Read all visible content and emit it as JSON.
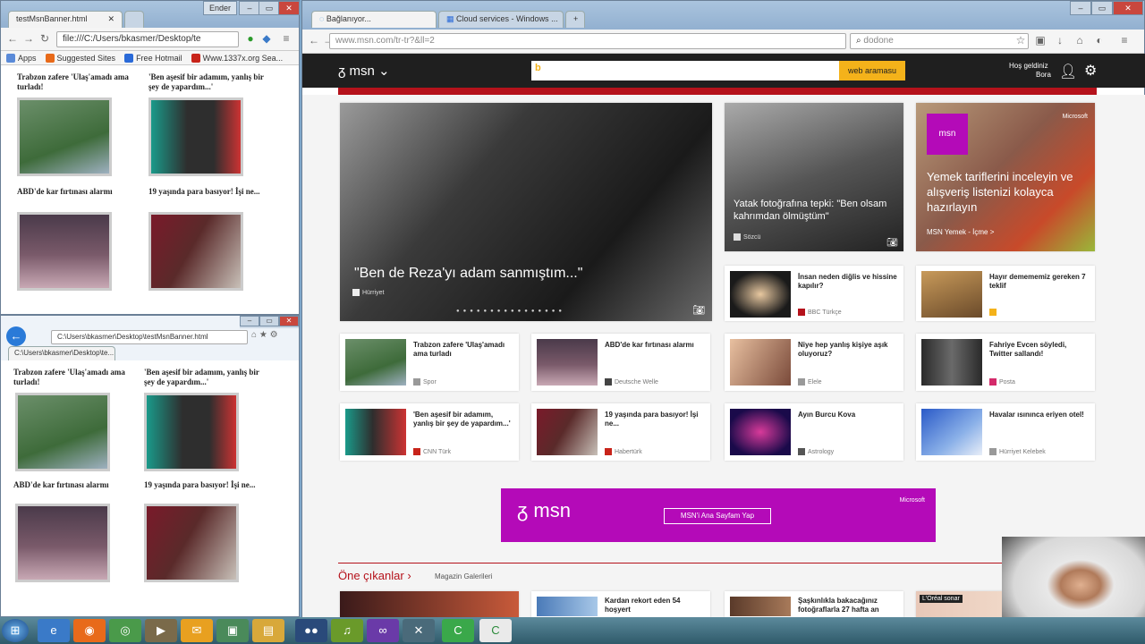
{
  "left_window": {
    "tab1": "testMsnBanner.html",
    "window_btn_label": "Ender",
    "url": "file:///C:/Users/bkasmer/Desktop/te",
    "bookmarks": [
      "Apps",
      "Suggested Sites",
      "Free Hotmail",
      "Www.1337x.org Sea..."
    ],
    "items": [
      {
        "caption": "Trabzon zafere 'Ulaş'amadı ama turladı!",
        "colors": [
          "#3a7a3a",
          "#6a8a6a",
          "#c0c8d0"
        ]
      },
      {
        "caption": "'Ben aşesif bir adamım, yanlış bir şey de yapardım...'",
        "colors": [
          "#1a9a8a",
          "#2e2e2e",
          "#c33"
        ]
      },
      {
        "caption": "ABD'de kar fırtınası alarmı",
        "colors": [
          "#5a4a5a",
          "#9a7a8a",
          "#c8b0b8"
        ]
      },
      {
        "caption": "19 yaşında para basıyor! İşi ne...",
        "colors": [
          "#7a1a2a",
          "#3a2a2a",
          "#c8c0b8"
        ]
      }
    ]
  },
  "ie_window": {
    "url": "C:\\Users\\bkasmer\\Desktop\\testMsnBanner.html",
    "tab": "C:\\Users\\bkasmer\\Desktop\\te...",
    "items": [
      {
        "caption": "Trabzon zafere 'Ulaş'amadı ama turladı!"
      },
      {
        "caption": "'Ben aşesif bir adamım, yanlış bir şey de yapardım...'"
      },
      {
        "caption": "ABD'de kar fırtınası alarmı"
      },
      {
        "caption": "19 yaşında para basıyor! İşi ne..."
      }
    ]
  },
  "right_window": {
    "tab1": "Bağlanıyor...",
    "tab2": "Cloud services - Windows ...",
    "url": "www.msn.com/tr-tr?&ll=2",
    "search_box": "dodone",
    "msn": {
      "logo": "msn",
      "search_button": "web aramasu",
      "greeting": "Hoş geldiniz",
      "user": "Bora"
    },
    "hero": {
      "title": "\"Ben de Reza'yı adam sanmıştım...\"",
      "source": "Hürriyet"
    },
    "card2": {
      "title": "Yatak fotoğrafına tepki: \"Ben olsam kahrımdan ölmüştüm\"",
      "source": "Sözcü"
    },
    "card3": {
      "brand": "Microsoft",
      "logo": "msn",
      "title": "Yemek tariflerini inceleyin ve alışveriş listenizi kolayca hazırlayın",
      "link": "MSN Yemek - İçme >"
    },
    "tiles_r1": [
      {
        "title": "İnsan neden diğlis ve hissine kapılır?",
        "source": "BBC Türkçe"
      },
      {
        "title": "Hayır demememiz gereken 7 teklif",
        "source": ""
      }
    ],
    "tiles_r2": [
      {
        "title": "Trabzon zafere 'Ulaş'amadı ama turladı",
        "source": "Spor"
      },
      {
        "title": "ABD'de kar fırtınası alarmı",
        "source": "Deutsche Welle"
      },
      {
        "title": "Niye hep yanlış kişiye aşık oluyoruz?",
        "source": "Elele"
      },
      {
        "title": "Fahriye Evcen söyledi, Twitter sallandı!",
        "source": "Posta"
      }
    ],
    "tiles_r3": [
      {
        "title": "'Ben aşesif bir adamım, yanlış bir şey de yapardım...'",
        "source": "CNN Türk"
      },
      {
        "title": "19 yaşında para basıyor! İşi ne...",
        "source": "Habertürk"
      },
      {
        "title": "Ayın Burcu Kova",
        "source": "Astrology"
      },
      {
        "title": "Havalar ısınınca eriyen otel!",
        "source": "Hürriyet Kelebek"
      }
    ],
    "banner": {
      "logo": "msn",
      "brand": "Microsoft",
      "button": "MSN'i Ana Sayfam Yap"
    },
    "featured": {
      "heading": "Öne çıkanlar ›",
      "tab": "Magazin Galerileri"
    },
    "bottom_tiles": [
      {
        "title": "Kardan rekort eden 54 hoşyert"
      },
      {
        "title": "Şaşkınlıkla bakacağınız fotoğraflarla 27 hafta an"
      },
      {
        "title": "L'Oréal sonar"
      }
    ]
  },
  "taskbar": {
    "items": [
      "start-orb",
      "ie-icon",
      "firefox-icon",
      "chrome-icon",
      "media-icon",
      "outlook-icon",
      "camtasia-icon",
      "explorer-icon",
      "game-icon",
      "spotify-icon",
      "visualstudio-icon",
      "tools-icon",
      "c-green-icon",
      "c-white-icon"
    ]
  }
}
